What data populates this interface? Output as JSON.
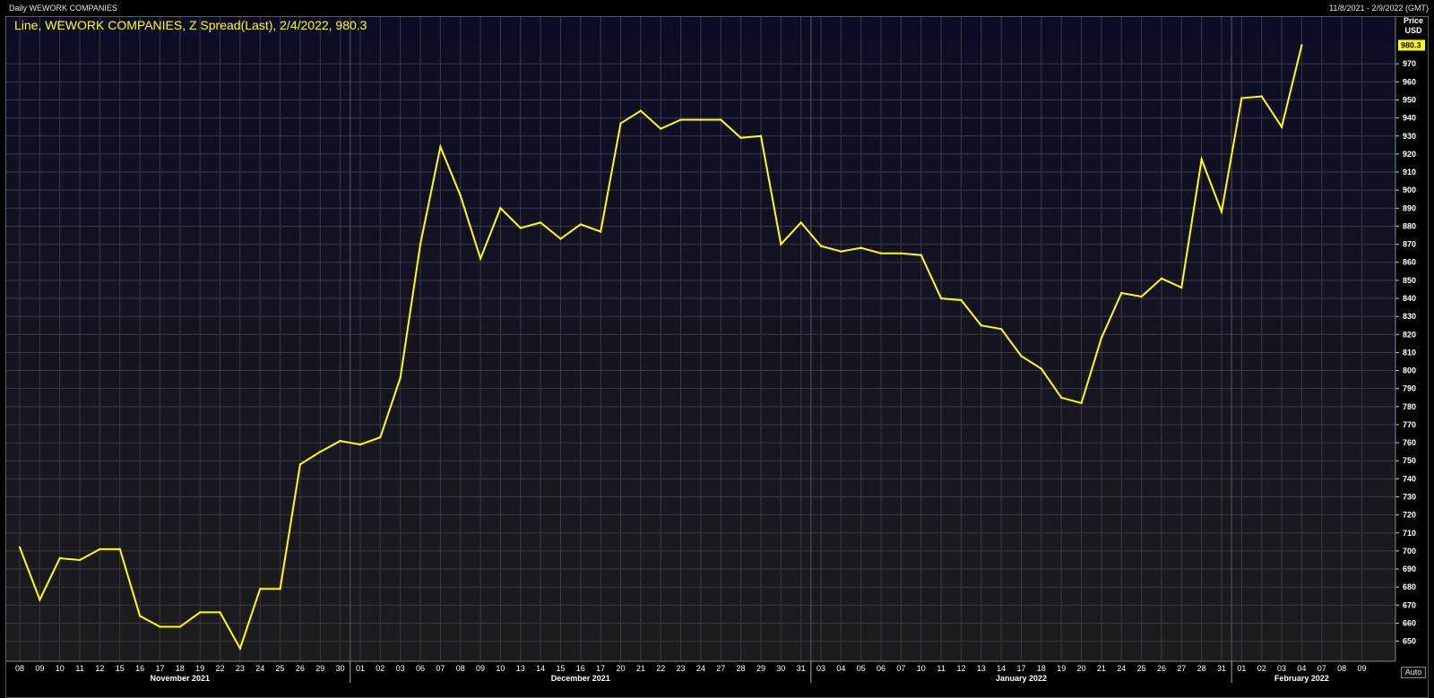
{
  "header": {
    "title": "Daily WEWORK COMPANIES",
    "range": "11/8/2021 - 2/9/2022 (GMT)"
  },
  "legend": "Line, WEWORK COMPANIES, Z Spread(Last), 2/4/2022, 980.3",
  "y_title": [
    "Price",
    "USD"
  ],
  "last_label": "980.3",
  "auto_label": "Auto",
  "colors": {
    "line": "#ffff00",
    "background_top": "#0c0c26",
    "background_bottom": "#1c1c1c",
    "grid": "#3a3a48",
    "text": "#ffffff"
  },
  "chart_data": {
    "type": "line",
    "series": [
      {
        "name": "WEWORK COMPANIES Z Spread(Last)",
        "x": [
          "2021-11-08",
          "2021-11-09",
          "2021-11-10",
          "2021-11-11",
          "2021-11-12",
          "2021-11-15",
          "2021-11-16",
          "2021-11-17",
          "2021-11-18",
          "2021-11-19",
          "2021-11-22",
          "2021-11-23",
          "2021-11-24",
          "2021-11-25",
          "2021-11-26",
          "2021-11-29",
          "2021-11-30",
          "2021-12-01",
          "2021-12-02",
          "2021-12-03",
          "2021-12-06",
          "2021-12-07",
          "2021-12-08",
          "2021-12-09",
          "2021-12-10",
          "2021-12-13",
          "2021-12-14",
          "2021-12-15",
          "2021-12-16",
          "2021-12-17",
          "2021-12-20",
          "2021-12-21",
          "2021-12-22",
          "2021-12-23",
          "2021-12-24",
          "2021-12-27",
          "2021-12-28",
          "2021-12-29",
          "2021-12-30",
          "2021-12-31",
          "2022-01-03",
          "2022-01-04",
          "2022-01-05",
          "2022-01-06",
          "2022-01-07",
          "2022-01-10",
          "2022-01-11",
          "2022-01-12",
          "2022-01-13",
          "2022-01-14",
          "2022-01-17",
          "2022-01-18",
          "2022-01-19",
          "2022-01-20",
          "2022-01-21",
          "2022-01-24",
          "2022-01-25",
          "2022-01-26",
          "2022-01-27",
          "2022-01-28",
          "2022-01-31",
          "2022-02-01",
          "2022-02-02",
          "2022-02-03",
          "2022-02-04"
        ],
        "values": [
          702,
          673,
          696,
          695,
          701,
          701,
          664,
          658,
          658,
          666,
          666,
          646,
          679,
          679,
          748,
          755,
          761,
          759,
          763,
          796,
          870,
          924,
          897,
          862,
          890,
          879,
          882,
          873,
          881,
          877,
          937,
          944,
          934,
          939,
          939,
          939,
          929,
          930,
          870,
          882,
          869,
          866,
          868,
          865,
          865,
          864,
          840,
          839,
          825,
          823,
          808,
          801,
          785,
          782,
          818,
          843,
          841,
          851,
          846,
          917,
          888,
          951,
          952,
          935,
          980.3
        ]
      }
    ],
    "x_tick_labels": [
      "08",
      "09",
      "10",
      "11",
      "12",
      "15",
      "16",
      "17",
      "18",
      "19",
      "22",
      "23",
      "24",
      "25",
      "26",
      "29",
      "30",
      "01",
      "02",
      "03",
      "06",
      "07",
      "08",
      "09",
      "10",
      "13",
      "14",
      "15",
      "16",
      "17",
      "20",
      "21",
      "22",
      "23",
      "24",
      "27",
      "28",
      "29",
      "30",
      "31",
      "03",
      "04",
      "05",
      "06",
      "07",
      "10",
      "11",
      "12",
      "13",
      "14",
      "17",
      "18",
      "19",
      "20",
      "21",
      "24",
      "25",
      "26",
      "27",
      "28",
      "31",
      "01",
      "02",
      "03",
      "04",
      "07",
      "08",
      "09"
    ],
    "months": [
      {
        "label": "November 2021",
        "start": 0,
        "end": 17
      },
      {
        "label": "December 2021",
        "start": 17,
        "end": 40
      },
      {
        "label": "January 2022",
        "start": 40,
        "end": 61
      },
      {
        "label": "February 2022",
        "start": 61,
        "end": 68
      }
    ],
    "y_ticks": [
      650,
      660,
      670,
      680,
      690,
      700,
      710,
      720,
      730,
      740,
      750,
      760,
      770,
      780,
      790,
      800,
      810,
      820,
      830,
      840,
      850,
      860,
      870,
      880,
      890,
      900,
      910,
      920,
      930,
      940,
      950,
      960,
      970
    ],
    "ylim": [
      640,
      987
    ],
    "ylabel": "Price USD",
    "grid": true,
    "axis_side": "right"
  }
}
